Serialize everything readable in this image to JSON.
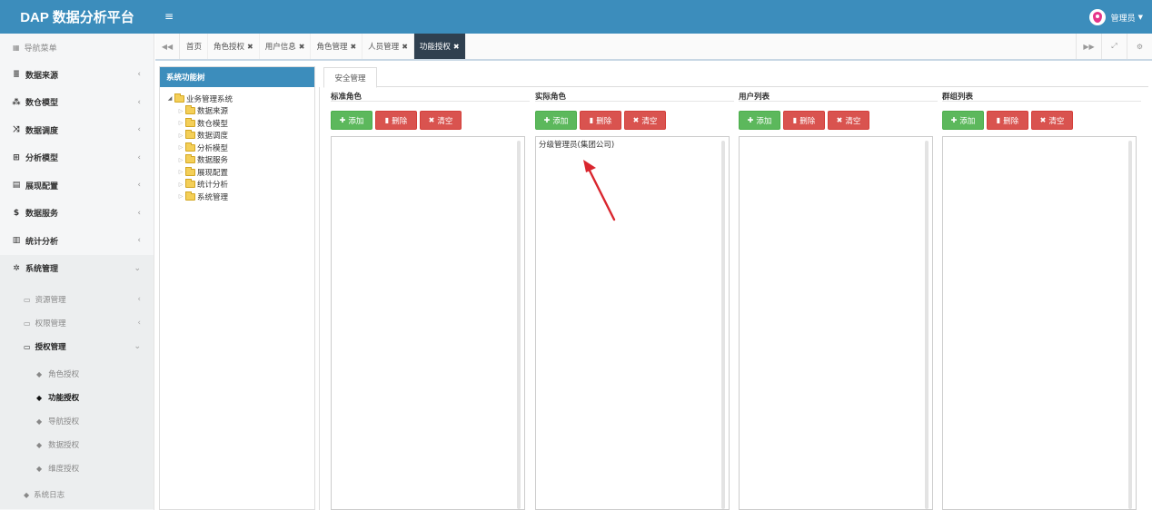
{
  "header": {
    "app_title": "DAP 数据分析平台",
    "user_name": "管理员"
  },
  "sidebar": {
    "nav_title": "导航菜单",
    "items": [
      {
        "label": "数据来源",
        "icon": "database-icon"
      },
      {
        "label": "数仓模型",
        "icon": "cubes-icon"
      },
      {
        "label": "数据调度",
        "icon": "shuffle-icon"
      },
      {
        "label": "分析模型",
        "icon": "sitemap-icon"
      },
      {
        "label": "展现配置",
        "icon": "film-icon"
      },
      {
        "label": "数据服务",
        "icon": "dollar-icon"
      },
      {
        "label": "统计分析",
        "icon": "bar-chart-icon"
      },
      {
        "label": "系统管理",
        "icon": "gear-icon"
      }
    ],
    "sub_items": [
      "资源管理",
      "权限管理",
      "授权管理"
    ],
    "leaf_items": [
      "角色授权",
      "功能授权",
      "导航授权",
      "数据授权",
      "维度授权"
    ],
    "log_item": "系统日志"
  },
  "tabs": [
    {
      "label": "首页",
      "closable": false
    },
    {
      "label": "角色授权",
      "closable": true
    },
    {
      "label": "用户信息",
      "closable": true
    },
    {
      "label": "角色管理",
      "closable": true
    },
    {
      "label": "人员管理",
      "closable": true
    },
    {
      "label": "功能授权",
      "closable": true,
      "active": true
    }
  ],
  "tree": {
    "title": "系统功能树",
    "root": "业务管理系统",
    "children": [
      "数据来源",
      "数仓模型",
      "数据调度",
      "分析模型",
      "数据服务",
      "展现配置",
      "统计分析",
      "系统管理"
    ]
  },
  "main": {
    "tab_label": "安全管理",
    "buttons": {
      "add": "添加",
      "delete": "删除",
      "clear": "清空"
    },
    "columns": [
      {
        "title": "标准角色",
        "entries": []
      },
      {
        "title": "实际角色",
        "entries": [
          "分级管理员(集团公司)"
        ]
      },
      {
        "title": "用户列表",
        "entries": []
      },
      {
        "title": "群组列表",
        "entries": []
      }
    ]
  },
  "colors": {
    "header_blue": "#3c8dbc",
    "active_tab": "#2f4050",
    "btn_green": "#5cb85c",
    "btn_red": "#d9534f",
    "arrow_red": "#d9262e"
  }
}
